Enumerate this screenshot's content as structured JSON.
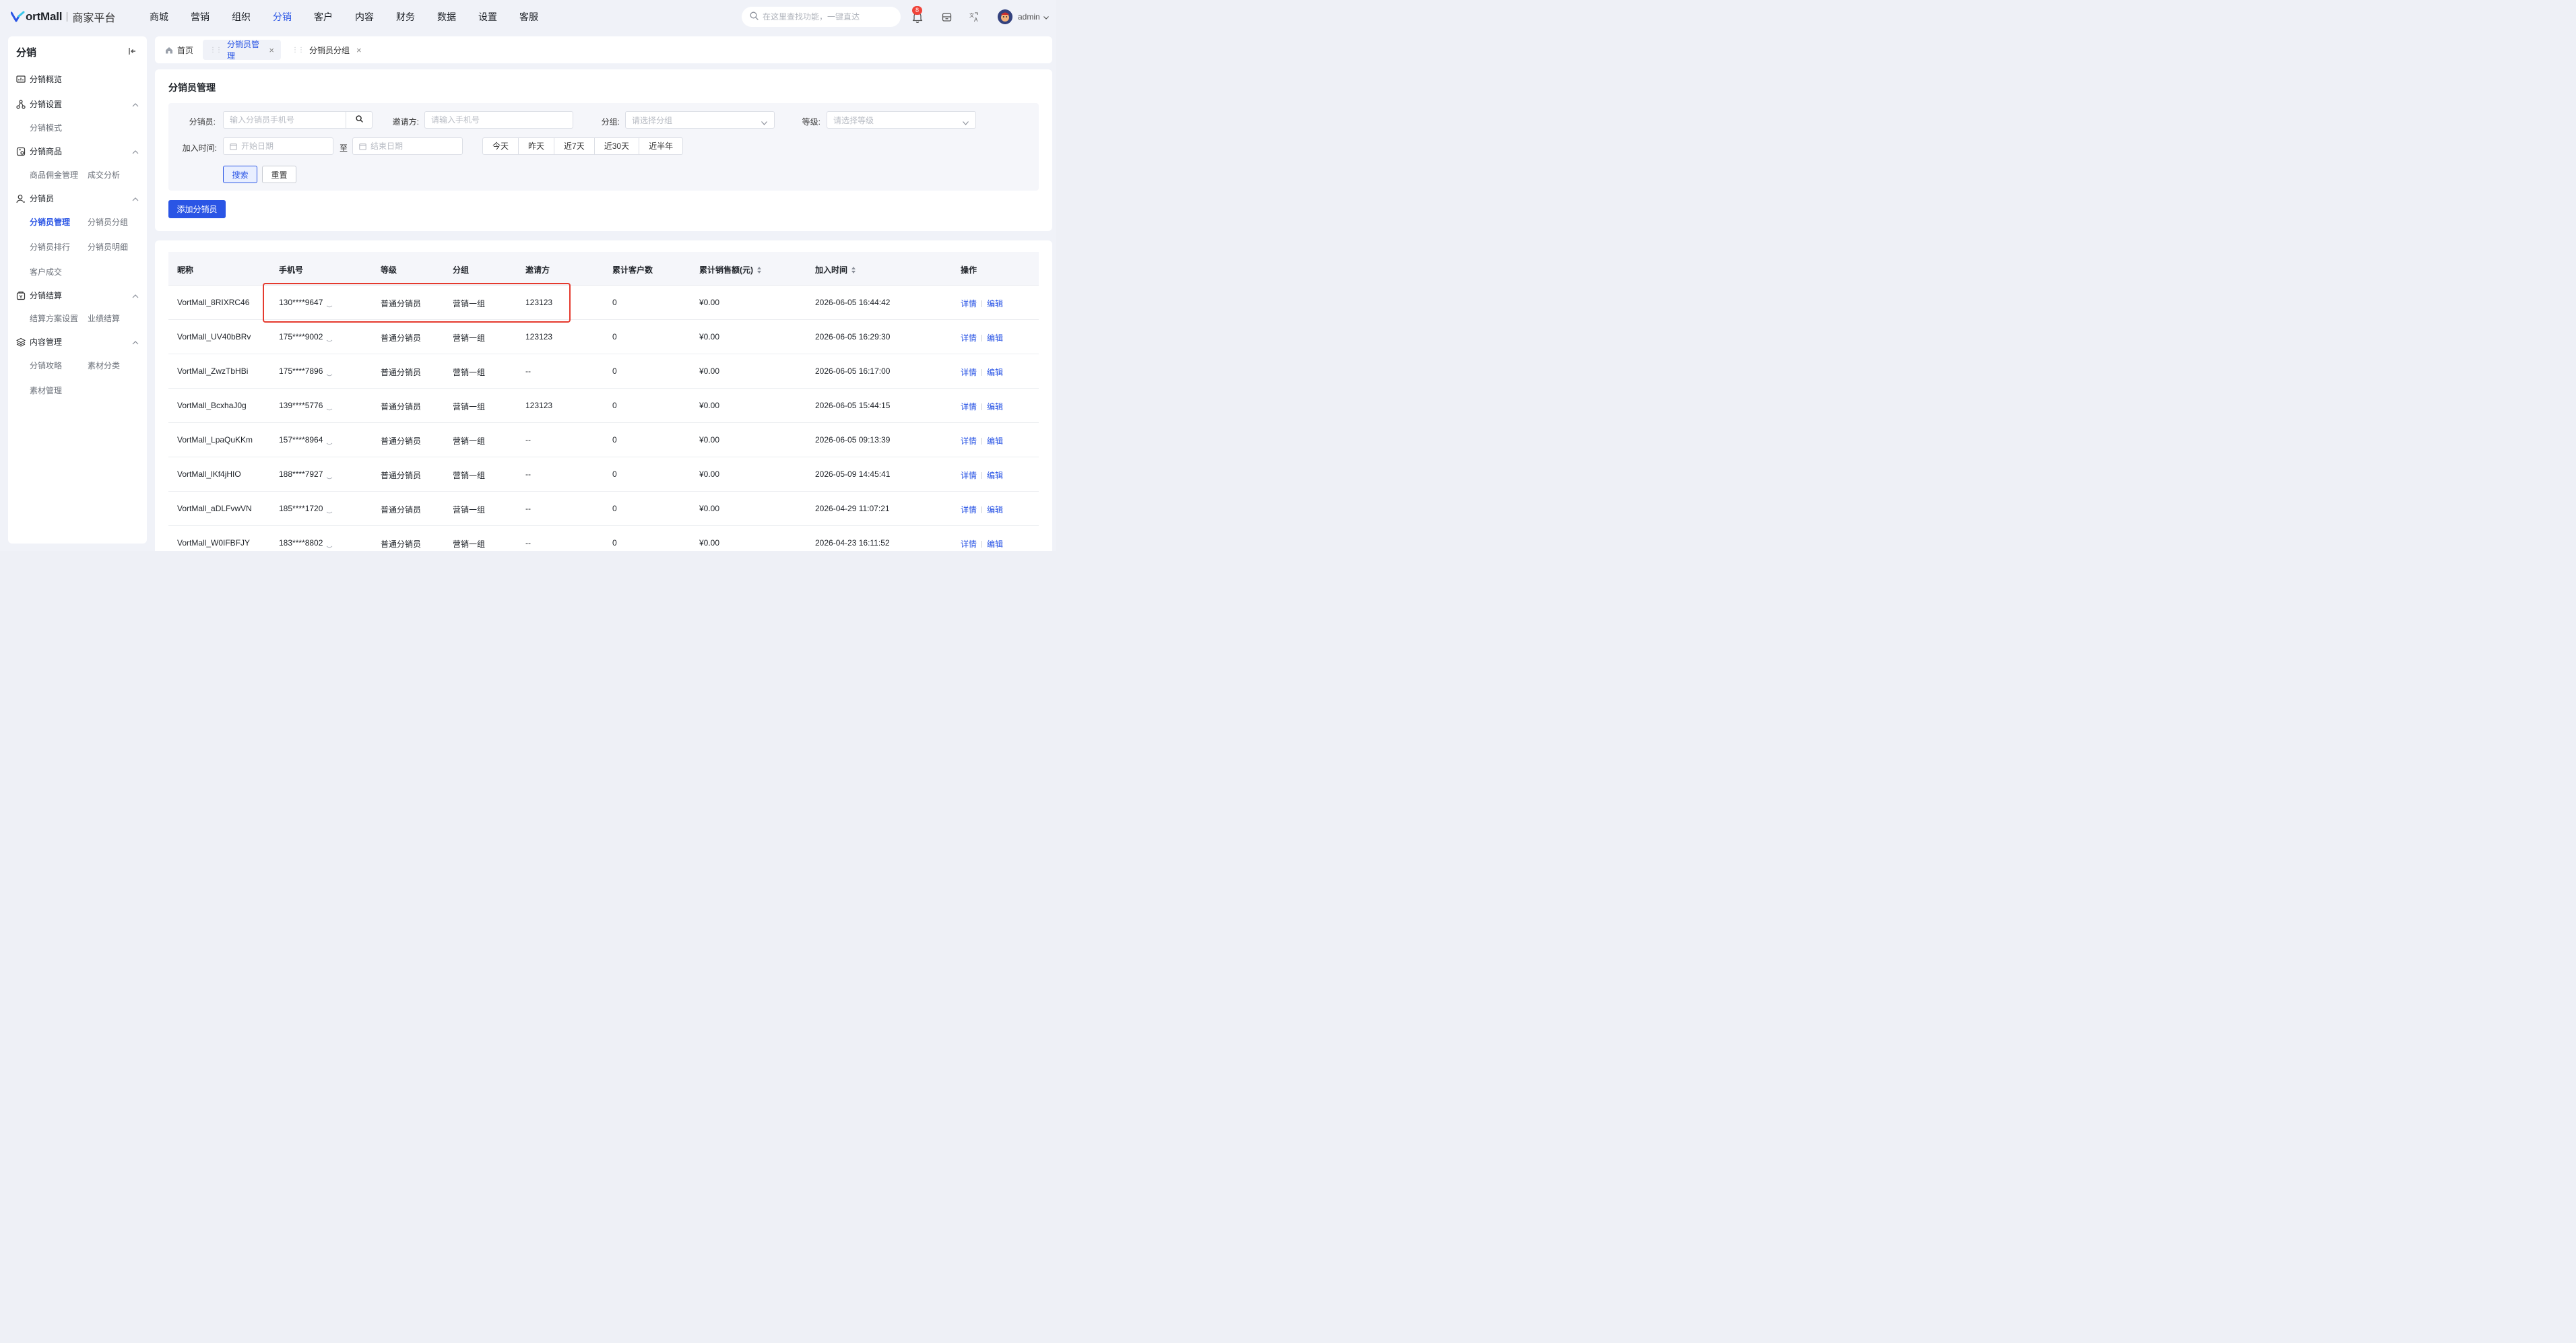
{
  "brand": {
    "name": "ortMall",
    "subtitle": "商家平台"
  },
  "nav": [
    {
      "label": "商城"
    },
    {
      "label": "营销"
    },
    {
      "label": "组织"
    },
    {
      "label": "分销"
    },
    {
      "label": "客户"
    },
    {
      "label": "内容"
    },
    {
      "label": "财务"
    },
    {
      "label": "数据"
    },
    {
      "label": "设置"
    },
    {
      "label": "客服"
    }
  ],
  "nav_active": "分销",
  "search": {
    "placeholder": "在这里查找功能，一键直达"
  },
  "notifications": {
    "count": "8"
  },
  "user": {
    "name": "admin"
  },
  "sidebar": {
    "title": "分销",
    "overview": "分销概览",
    "settings": {
      "label": "分销设置",
      "items": [
        "分销模式"
      ]
    },
    "products": {
      "label": "分销商品",
      "items": [
        "商品佣金管理",
        "成交分析"
      ]
    },
    "distributors": {
      "label": "分销员",
      "items": [
        "分销员管理",
        "分销员分组",
        "分销员排行",
        "分销员明细",
        "客户成交"
      ]
    },
    "settlement": {
      "label": "分销结算",
      "items": [
        "结算方案设置",
        "业绩结算"
      ]
    },
    "content": {
      "label": "内容管理",
      "items": [
        "分销攻略",
        "素材分类",
        "素材管理"
      ]
    }
  },
  "tabs": {
    "home": "首页",
    "items": [
      "分销员管理",
      "分销员分组"
    ]
  },
  "page": {
    "title": "分销员管理"
  },
  "filters": {
    "distributor_label": "分销员:",
    "distributor_placeholder": "输入分销员手机号",
    "inviter_label": "邀请方:",
    "inviter_placeholder": "请输入手机号",
    "group_label": "分组:",
    "group_placeholder": "请选择分组",
    "level_label": "等级:",
    "level_placeholder": "请选择等级",
    "join_label": "加入时间:",
    "start_placeholder": "开始日期",
    "to": "至",
    "end_placeholder": "结束日期",
    "quick": [
      "今天",
      "昨天",
      "近7天",
      "近30天",
      "近半年"
    ],
    "search_btn": "搜索",
    "reset_btn": "重置"
  },
  "add_button": "添加分销员",
  "table": {
    "columns": [
      "昵称",
      "手机号",
      "等级",
      "分组",
      "邀请方",
      "累计客户数",
      "累计销售额(元)",
      "加入时间",
      "操作"
    ],
    "rows": [
      {
        "nick": "VortMall_8RIXRC46",
        "phone": "130****9647",
        "level": "普通分销员",
        "group": "营销一组",
        "inviter": "123123",
        "customers": "0",
        "sales": "¥0.00",
        "joined": "2026-06-05 16:44:42"
      },
      {
        "nick": "VortMall_UV40bBRv",
        "phone": "175****9002",
        "level": "普通分销员",
        "group": "营销一组",
        "inviter": "123123",
        "customers": "0",
        "sales": "¥0.00",
        "joined": "2026-06-05 16:29:30"
      },
      {
        "nick": "VortMall_ZwzTbHBi",
        "phone": "175****7896",
        "level": "普通分销员",
        "group": "营销一组",
        "inviter": "--",
        "customers": "0",
        "sales": "¥0.00",
        "joined": "2026-06-05 16:17:00"
      },
      {
        "nick": "VortMall_BcxhaJ0g",
        "phone": "139****5776",
        "level": "普通分销员",
        "group": "营销一组",
        "inviter": "123123",
        "customers": "0",
        "sales": "¥0.00",
        "joined": "2026-06-05 15:44:15"
      },
      {
        "nick": "VortMall_LpaQuKKm",
        "phone": "157****8964",
        "level": "普通分销员",
        "group": "营销一组",
        "inviter": "--",
        "customers": "0",
        "sales": "¥0.00",
        "joined": "2026-06-05 09:13:39"
      },
      {
        "nick": "VortMall_lKf4jHIO",
        "phone": "188****7927",
        "level": "普通分销员",
        "group": "营销一组",
        "inviter": "--",
        "customers": "0",
        "sales": "¥0.00",
        "joined": "2026-05-09 14:45:41"
      },
      {
        "nick": "VortMall_aDLFvwVN",
        "phone": "185****1720",
        "level": "普通分销员",
        "group": "营销一组",
        "inviter": "--",
        "customers": "0",
        "sales": "¥0.00",
        "joined": "2026-04-29 11:07:21"
      },
      {
        "nick": "VortMall_W0IFBFJY",
        "phone": "183****8802",
        "level": "普通分销员",
        "group": "营销一组",
        "inviter": "--",
        "customers": "0",
        "sales": "¥0.00",
        "joined": "2026-04-23 16:11:52"
      }
    ],
    "actions": {
      "detail": "详情",
      "edit": "编辑"
    }
  },
  "colors": {
    "accent": "#2a55e5",
    "highlight": "#e53a2e",
    "background": "#f0f2f8"
  }
}
